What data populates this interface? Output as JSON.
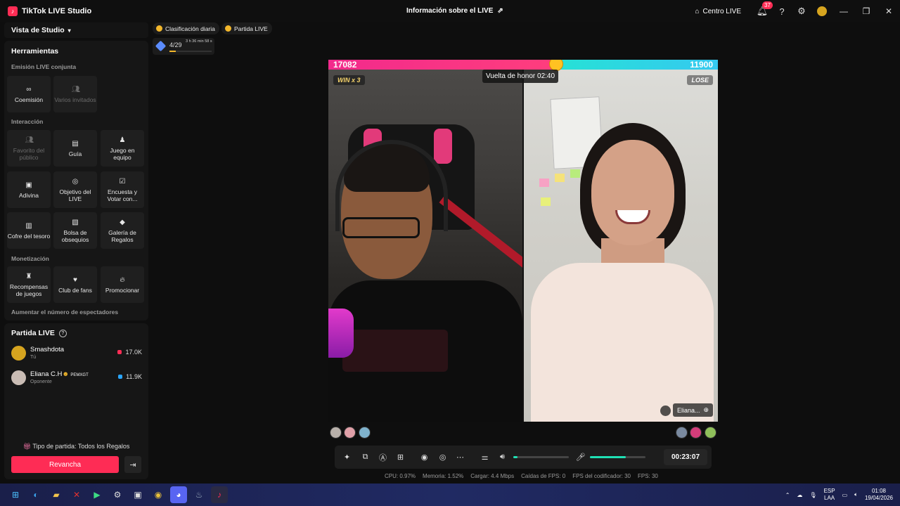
{
  "app": {
    "title": "TikTok LIVE Studio",
    "center_title": "Información sobre el LIVE",
    "centro_live": "Centro LIVE",
    "notifications_count": "37"
  },
  "left": {
    "studio_view": "Vista de Studio",
    "tools_title": "Herramientas",
    "sections": {
      "coemision": "Emisión LIVE conjunta",
      "interaccion": "Interacción",
      "monetizacion": "Monetización",
      "aumentar": "Aumentar el número de espectadores"
    },
    "tools": {
      "coemision": "Coemisión",
      "varios_invitados": "Varios invitados",
      "favorito": "Favorito del público",
      "guia": "Guía",
      "juego_equipo": "Juego en equipo",
      "adivina": "Adivina",
      "objetivo": "Objetivo del LIVE",
      "encuesta": "Encuesta y Votar con...",
      "cofre": "Cofre del tesoro",
      "bolsa": "Bolsa de obsequios",
      "galeria": "Galería de Regalos",
      "recompensas": "Recompensas de juegos",
      "club_fans": "Club de fans",
      "promocionar": "Promocionar"
    },
    "match": {
      "title": "Partida LIVE",
      "players": [
        {
          "name": "Smashdota",
          "role": "Tú",
          "score": "17.0K",
          "color": "#ff2d55"
        },
        {
          "name": "Eliana C.H",
          "tag": "PEMXGT",
          "role": "Oponente",
          "score": "11.9K",
          "color": "#2aa6ff"
        }
      ],
      "match_type": "Tipo de partida: Todos los Regalos",
      "rematch": "Revancha"
    }
  },
  "chips": {
    "daily_rank": "Clasificación diaria",
    "live_match": "Partida LIVE",
    "rank_count": "4/29",
    "rank_time": "3 h 36 min 58 s",
    "rank_progress": 0.15
  },
  "battle": {
    "score_left": "17082",
    "score_right": "11900",
    "score_left_share": 0.589,
    "honor_lap": "Vuelta de honor 02:40",
    "win_tag": "WIN x 3",
    "lose_tag": "LOSE",
    "opponent_name": "Eliana..."
  },
  "controls": {
    "timer": "00:23:07",
    "volume_level": 0.08,
    "mic_level": 0.65
  },
  "stats": {
    "cpu": "CPU:  0.97%",
    "memoria": "Memoria:  1.52%",
    "cargar": "Cargar:  4.4 Mbps",
    "caidas": "Caídas de FPS:  0",
    "fps_cod": "FPS del codificador:  30",
    "fps": "FPS:  30"
  },
  "taskbar": {
    "lang": "ESP",
    "layout": "LAA",
    "time": "01:08",
    "date": "19/04/2026"
  }
}
